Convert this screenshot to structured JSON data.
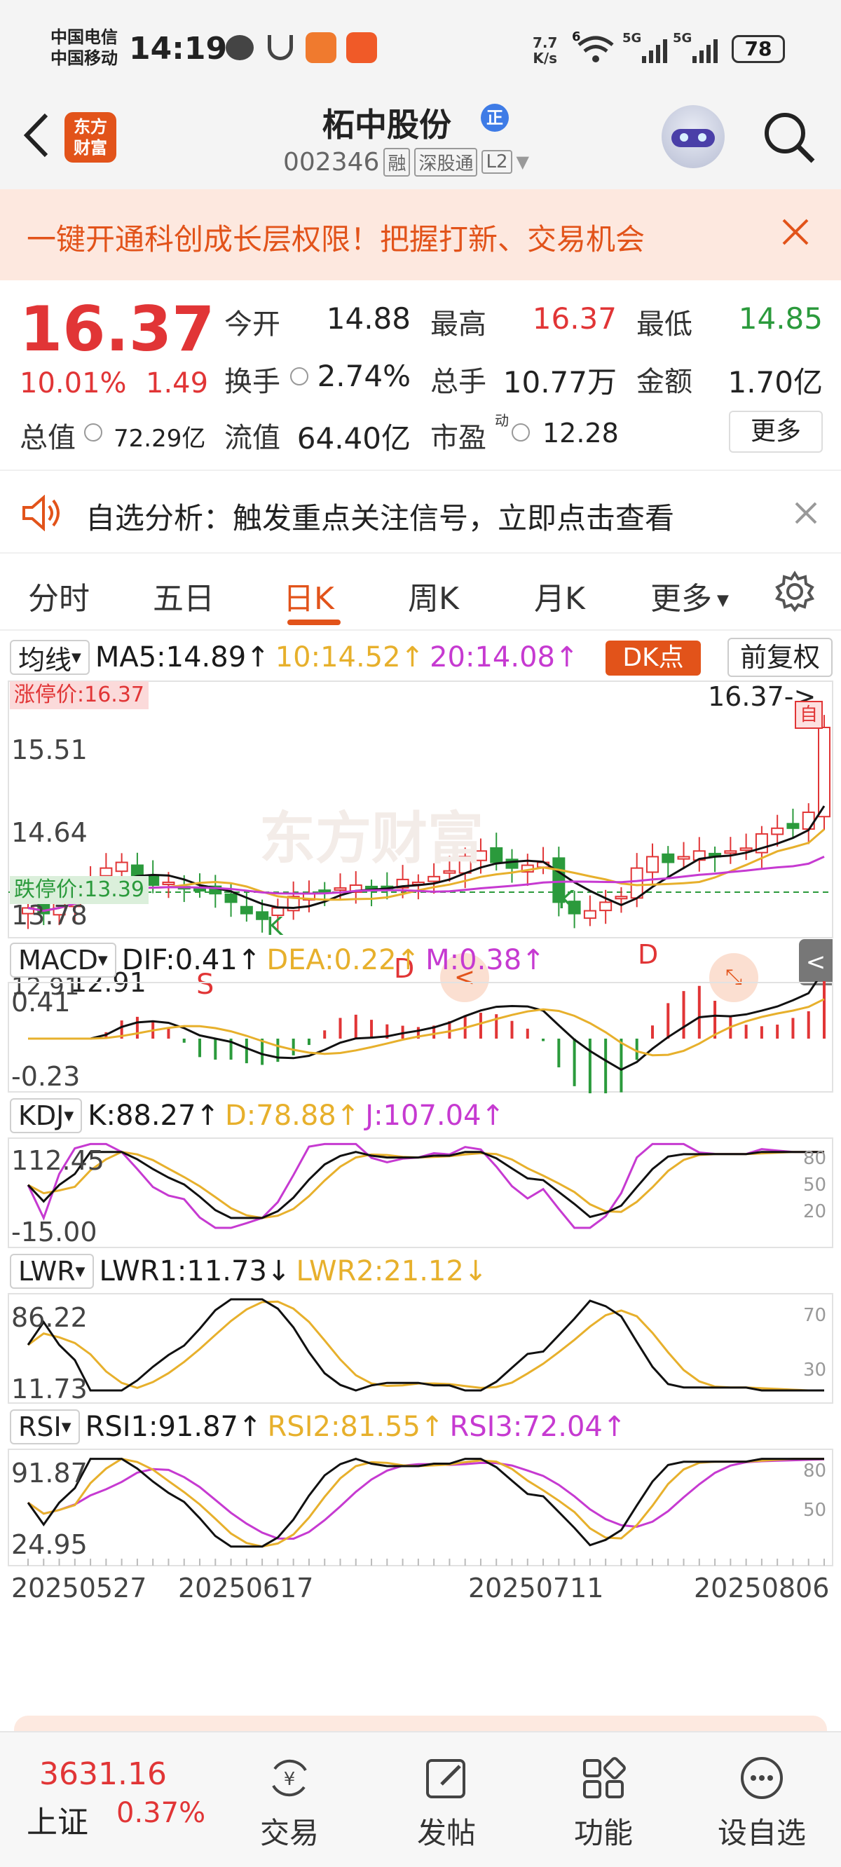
{
  "status_bar": {
    "carrier1": "中国电信",
    "carrier2": "中国移动",
    "time": "14:19",
    "net_speed_value": "7.7",
    "net_speed_unit": "K/s",
    "wifi_badge": "6",
    "signal1_label": "5G",
    "signal2_label": "5G",
    "battery": "78"
  },
  "header": {
    "logo_line1": "东方",
    "logo_line2": "财富",
    "stock_name": "柘中股份",
    "badge": "正",
    "stock_code": "002346",
    "tag1": "融",
    "tag2": "深股通",
    "tag3": "L2"
  },
  "banner": {
    "text": "一键开通科创成长层权限！把握打新、交易机会"
  },
  "quote": {
    "price": "16.37",
    "change_pct": "10.01%",
    "change_amt": "1.49",
    "open_label": "今开",
    "open": "14.88",
    "high_label": "最高",
    "high": "16.37",
    "low_label": "最低",
    "low": "14.85",
    "turnover_label": "换手",
    "turnover": "2.74%",
    "volume_label": "总手",
    "volume": "10.77万",
    "amount_label": "金额",
    "amount": "1.70亿",
    "mktcap_label": "总值",
    "mktcap": "72.29亿",
    "float_label": "流值",
    "float_cap": "64.40亿",
    "pe_label": "市盈",
    "pe_sup": "动",
    "pe": "12.28",
    "more_button": "更多"
  },
  "analysis": {
    "text": "自选分析：触发重点关注信号，立即点击查看"
  },
  "tabs": [
    "分时",
    "五日",
    "日K",
    "周K",
    "月K",
    "更多"
  ],
  "active_tab": "日K",
  "kline": {
    "selector": "均线",
    "ma5": "MA5:14.89↑",
    "ma10": "10:14.52↑",
    "ma20": "20:14.08↑",
    "dk_button": "DK点",
    "fq_button": "前复权",
    "limit_up_label": "涨停价:16.37",
    "limit_down_label": "跌停价:13.39",
    "price_end_label": "16.37->",
    "low_label": "12.91",
    "left_overlap_label": "12.91",
    "y_ticks": [
      "15.51",
      "14.64",
      "13.78"
    ],
    "watermark": "东方财富",
    "markers": [
      "S",
      "K",
      "D",
      "K",
      "D"
    ],
    "self_marker": "自"
  },
  "macd": {
    "selector": "MACD",
    "dif": "DIF:0.41↑",
    "dea": "DEA:0.22↑",
    "m": "M:0.38↑",
    "y_top": "0.41",
    "y_bottom": "-0.23"
  },
  "kdj": {
    "selector": "KDJ",
    "k": "K:88.27↑",
    "d": "D:78.88↑",
    "j": "J:107.04↑",
    "y_top": "112.45",
    "y_bottom": "-15.00",
    "right_ticks": [
      "80",
      "50",
      "20"
    ]
  },
  "lwr": {
    "selector": "LWR",
    "lwr1": "LWR1:11.73↓",
    "lwr2": "LWR2:21.12↓",
    "y_top": "86.22",
    "y_bottom": "11.73",
    "right_ticks": [
      "70",
      "30"
    ]
  },
  "rsi": {
    "selector": "RSI",
    "rsi1": "RSI1:91.87↑",
    "rsi2": "RSI2:81.55↑",
    "rsi3": "RSI3:72.04↑",
    "y_top": "91.87",
    "y_bottom": "24.95",
    "right_ticks": [
      "80",
      "50"
    ]
  },
  "x_dates": [
    "20250527",
    "20250617",
    "20250711",
    "20250806"
  ],
  "bottom_nav": {
    "index_value": "3631.16",
    "index_name": "上证",
    "index_change": "0.37%",
    "items": [
      "交易",
      "发帖",
      "功能",
      "设自选"
    ]
  },
  "colors": {
    "up": "#e13536",
    "down": "#2b9a3c",
    "ma10": "#e7b02c",
    "ma20": "#c63ad1",
    "accent": "#e2531a"
  }
}
